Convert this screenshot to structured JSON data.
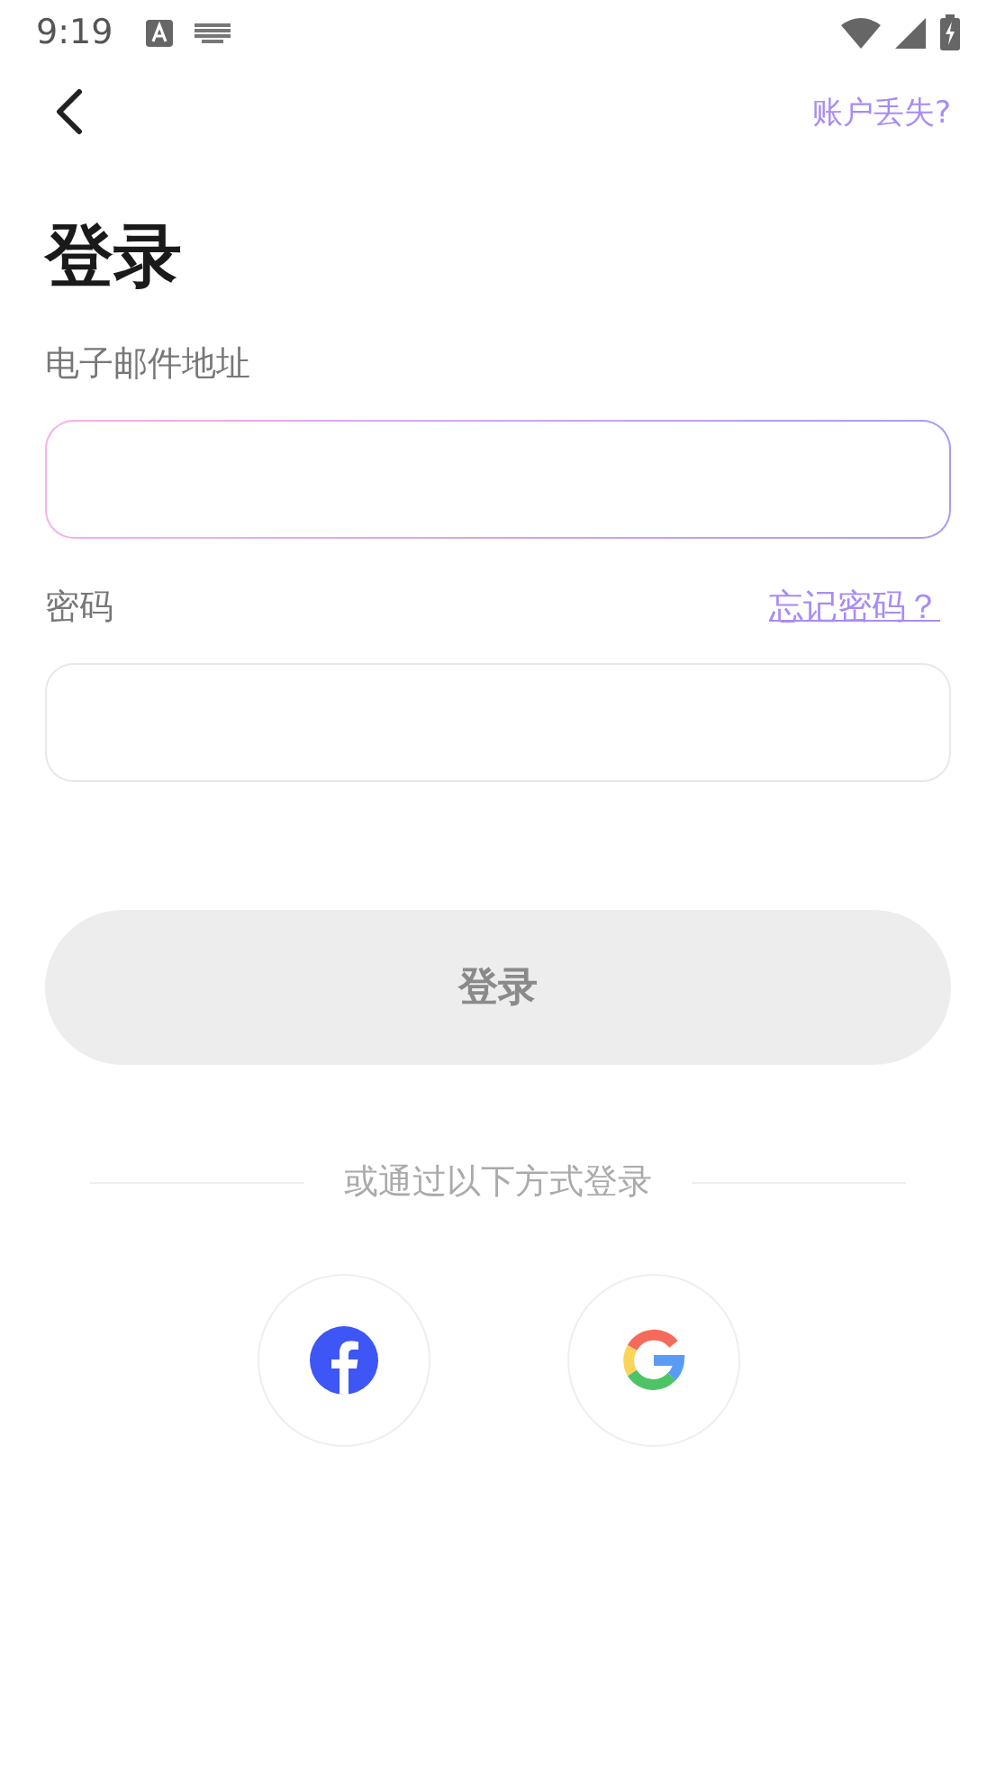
{
  "status_bar": {
    "time": "9:19"
  },
  "header": {
    "lost_account_link": "账户丢失?"
  },
  "title": "登录",
  "email": {
    "label": "电子邮件地址",
    "focused": true
  },
  "password": {
    "label": "密码",
    "forgot_link": "忘记密码？",
    "focused": false
  },
  "login_button": {
    "label": "登录",
    "disabled": true
  },
  "divider_text": "或通过以下方式登录",
  "social": [
    {
      "kind": "facebook"
    },
    {
      "kind": "google"
    }
  ]
}
